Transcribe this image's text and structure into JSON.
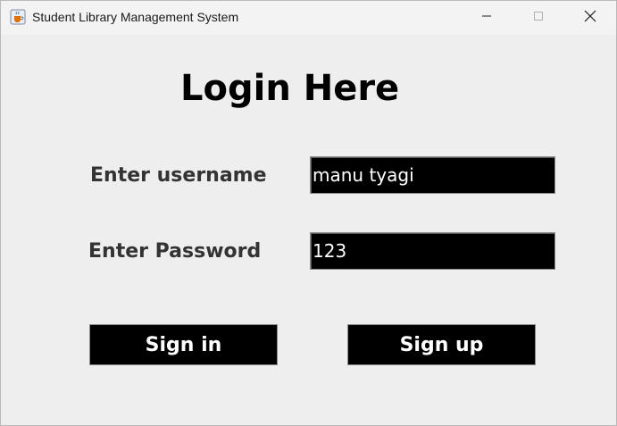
{
  "window": {
    "title": "Student Library Management System",
    "icon": "java-coffee-cup-icon"
  },
  "titlebar_controls": {
    "minimize": "minimize-icon",
    "maximize": "maximize-icon",
    "close": "close-icon"
  },
  "form": {
    "heading": "Login Here",
    "username_label": "Enter username",
    "username_value": "manu tyagi",
    "password_label": "Enter Password",
    "password_value": "123",
    "signin_label": "Sign in",
    "signup_label": "Sign up"
  },
  "colors": {
    "window_background": "#eeeeee",
    "field_background": "#000000",
    "field_text": "#ffffff",
    "button_background": "#000000",
    "button_text": "#ffffff"
  }
}
